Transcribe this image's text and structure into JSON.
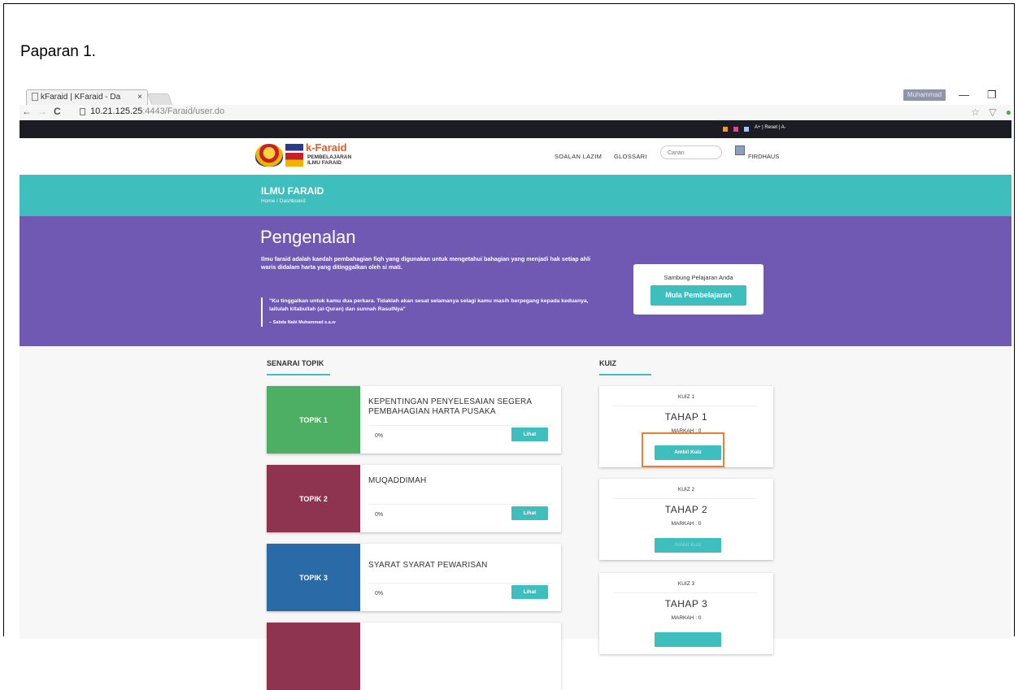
{
  "caption": "Paparan 1.",
  "browser": {
    "tab_title": "kFaraid | KFaraid - Da",
    "tab_close": "×",
    "profile": "Muhammad",
    "url_host": "10.21.125.25",
    "url_path": ":4443/Faraid/user.do",
    "nav_back": "←",
    "nav_forward": "→",
    "nav_reload": "C",
    "win_min": "—",
    "win_max": "❐",
    "star": "☆"
  },
  "accessibility": "A+ | Reset | A-",
  "accent_colors": {
    "orange": "#f39c12",
    "pink": "#e84393",
    "blue": "#a0c4ff",
    "teal": "#3ebebd",
    "purple": "#6f59b3"
  },
  "logo": {
    "title": "k-Faraid",
    "subtitle_line1": "PEMBELAJARAN",
    "subtitle_line2": "ILMU FARAID"
  },
  "menu": {
    "faq": "SOALAN LAZIM",
    "glossary": "GLOSSARI",
    "search_placeholder": "Carian",
    "user": "FIRDHAUS"
  },
  "banner": {
    "title": "ILMU FARAID",
    "breadcrumb": "Home  /  Dashboard"
  },
  "hero": {
    "title": "Pengenalan",
    "text": "Ilmu faraid adalah kaedah pembahagian fiqh yang digunakan untuk mengetahui bahagian yang menjadi hak setiap ahli waris didalam harta yang ditinggalkan oleh si mati.",
    "quote": "\"Ku tinggalkan untuk kamu dua perkara. Tidaklah akan sesat selamanya selagi kamu masih berpegang kepada keduanya, iaitulah kitabullah (al-Quran) dan sunnah RasulNya\"",
    "quote_source": "– Sabda Nabi Muhammad s.a.w",
    "cta_label": "Sambung Pelajaran Anda",
    "cta_button": "Mula Pembelajaran"
  },
  "topics_title": "SENARAI TOPIK",
  "topics": [
    {
      "tag": "TOPIK 1",
      "name": "KEPENTINGAN PENYELESAIAN SEGERA PEMBAHAGIAN HARTA PUSAKA",
      "progress": "0%",
      "button": "Lihat",
      "color": "#4caf63"
    },
    {
      "tag": "TOPIK 2",
      "name": "MUQADDIMAH",
      "progress": "0%",
      "button": "Lihat",
      "color": "#8e3450"
    },
    {
      "tag": "TOPIK 3",
      "name": "SYARAT SYARAT PEWARISAN",
      "progress": "0%",
      "button": "Lihat",
      "color": "#2a6aa6"
    },
    {
      "tag": "",
      "name": "",
      "progress": "",
      "button": "",
      "color": "#8e3450"
    }
  ],
  "quiz_title": "KUIZ",
  "quizzes": [
    {
      "name": "KUIZ 1",
      "level": "TAHAP 1",
      "score": "MARKAH : 0",
      "button": "Ambil Kuiz"
    },
    {
      "name": "KUIZ 2",
      "level": "TAHAP 2",
      "score": "MARKAH : 0",
      "button": "Ambil Kuiz"
    },
    {
      "name": "KUIZ 3",
      "level": "TAHAP 3",
      "score": "MARKAH : 0",
      "button": ""
    }
  ]
}
